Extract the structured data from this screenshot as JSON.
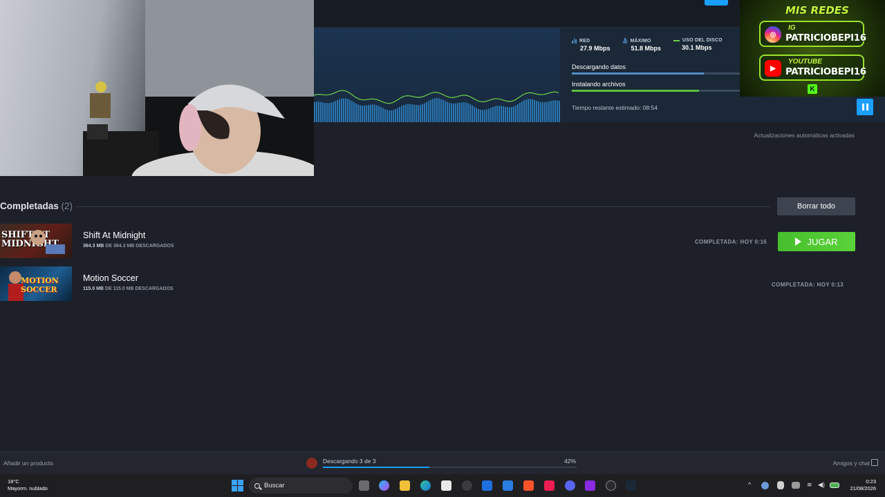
{
  "download_panel": {
    "stats": [
      {
        "label": "RED",
        "value": "27.9 Mbps",
        "color": "#4e90c8"
      },
      {
        "label": "MÁXIMO",
        "value": "51.8 Mbps",
        "color": "#4e90c8"
      },
      {
        "label": "USO DEL DISCO",
        "value": "30.1 Mbps",
        "color": "#6fd44a"
      }
    ],
    "phase_download": {
      "label": "Descargando datos",
      "progress": 0.78,
      "color": "#4e90c8"
    },
    "phase_install": {
      "label": "Instalando archivos",
      "progress": 0.75,
      "color": "#5cc13a"
    },
    "eta": "Tiempo restante estimado: 08:54"
  },
  "overlay": {
    "title": "MIS REDES",
    "instagram_prefix": "IG",
    "instagram_handle": "PATRICIOBEPI16",
    "youtube_prefix": "YOUTUBE",
    "youtube_handle": "PATRICIOBEPI16",
    "kick_badge": "K"
  },
  "auto_updates": "Actualizaciones automáticas activadas",
  "completed": {
    "title": "Completadas",
    "count": "(2)",
    "clear_label": "Borrar todo",
    "games": [
      {
        "thumb_text": "SHIFT AT MIDNIGHT",
        "name": "Shift At Midnight",
        "size_done": "364.3 MB",
        "size_rest": "DE 364.3 MB DESCARGADOS",
        "status": "COMPLETADA: HOY 0:16",
        "play_label": "JUGAR"
      },
      {
        "thumb_text": "MOTION SOCCER",
        "name": "Motion Soccer",
        "size_done": "115.0 MB",
        "size_rest": "DE 115.0 MB DESCARGADOS",
        "status": "COMPLETADA: HOY 0:13"
      }
    ]
  },
  "footer": {
    "add_product": "Añadir un producto",
    "download_status": "Descargando 3 de 3",
    "download_percent": "42%",
    "download_progress": 0.42,
    "friends": "Amigos y chat"
  },
  "taskbar": {
    "temperature": "18°C",
    "weather": "Mayorm. nublado",
    "search": "Buscar",
    "time": "0:23",
    "date": "21/08/2026"
  },
  "colors": {
    "accent": "#1a9fff",
    "play_green": "#59d338",
    "background": "#1d2029"
  }
}
